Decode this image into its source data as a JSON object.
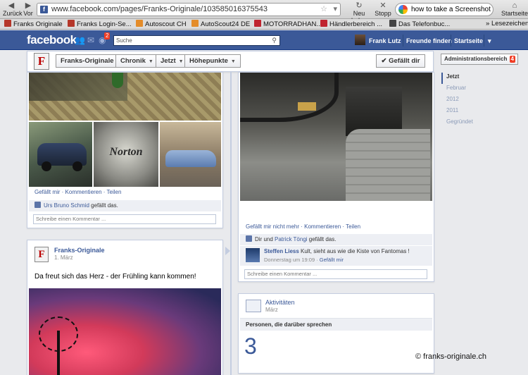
{
  "browser": {
    "back_label": "Zurück",
    "forward_label": "Vor",
    "url": "www.facebook.com/pages/Franks-Originale/103585016375543",
    "reload_label": "Neu laden",
    "stop_label": "Stopp",
    "search_query": "how to take a Screenshot on",
    "home_label": "Startseite",
    "bookmarks": [
      "Franks Originale",
      "Franks Login-Se...",
      "Autoscout CH",
      "AutoScout24 DE",
      "MOTORRADHAN...",
      "Händlerbereich ...",
      "Das Telefonbuc...",
      "Lesezeichen"
    ]
  },
  "fb": {
    "logo": "facebook",
    "notification_count": "2",
    "search_placeholder": "Suche",
    "user_name": "Frank Lutz",
    "find_friends": "Freunde finden",
    "home": "Startseite"
  },
  "page": {
    "logo_letter": "F",
    "name_tab": "Franks-Originale",
    "chronik_tab": "Chronik",
    "jetzt_tab": "Jetzt",
    "highlights_tab": "Höhepunkte",
    "like_button": "✔ Gefällt dir",
    "admin_label": "Administrationsbereich",
    "admin_count": "4"
  },
  "timeline_nav": [
    "Jetzt",
    "Februar",
    "2012",
    "2011",
    "Gegründet"
  ],
  "post1": {
    "actions": "Gefällt mir · Kommentieren · Teilen",
    "liker": "Urs Bruno Schmid",
    "liked_suffix": " gefällt das.",
    "comment_placeholder": "Schreibe einen Kommentar ..."
  },
  "post2": {
    "actions": "Gefällt mir nicht mehr · Kommentieren · Teilen",
    "like_prefix": "Dir und ",
    "liker": "Patrick Töngi",
    "liked_suffix": " gefällt das.",
    "commenter": "Steffen Liess",
    "comment_text": " Kult, sieht aus wie die Kiste von Fantomas !",
    "comment_time": "Donnerstag um 19:09 · ",
    "comment_like": "Gefällt mir",
    "comment_placeholder": "Schreibe einen Kommentar ..."
  },
  "post3": {
    "author": "Franks-Originale",
    "date": "1. März",
    "text": "Da freut sich das Herz - der Frühling kann kommen!"
  },
  "activity": {
    "title": "Aktivitäten",
    "subtitle": "März",
    "talking_label": "Personen, die darüber sprechen",
    "talking_count": "3"
  },
  "watermark": "© franks-originale.ch",
  "colors": {
    "fb_blue": "#3b5998",
    "link_blue": "#3b5998",
    "badge_red": "#f03d25"
  }
}
